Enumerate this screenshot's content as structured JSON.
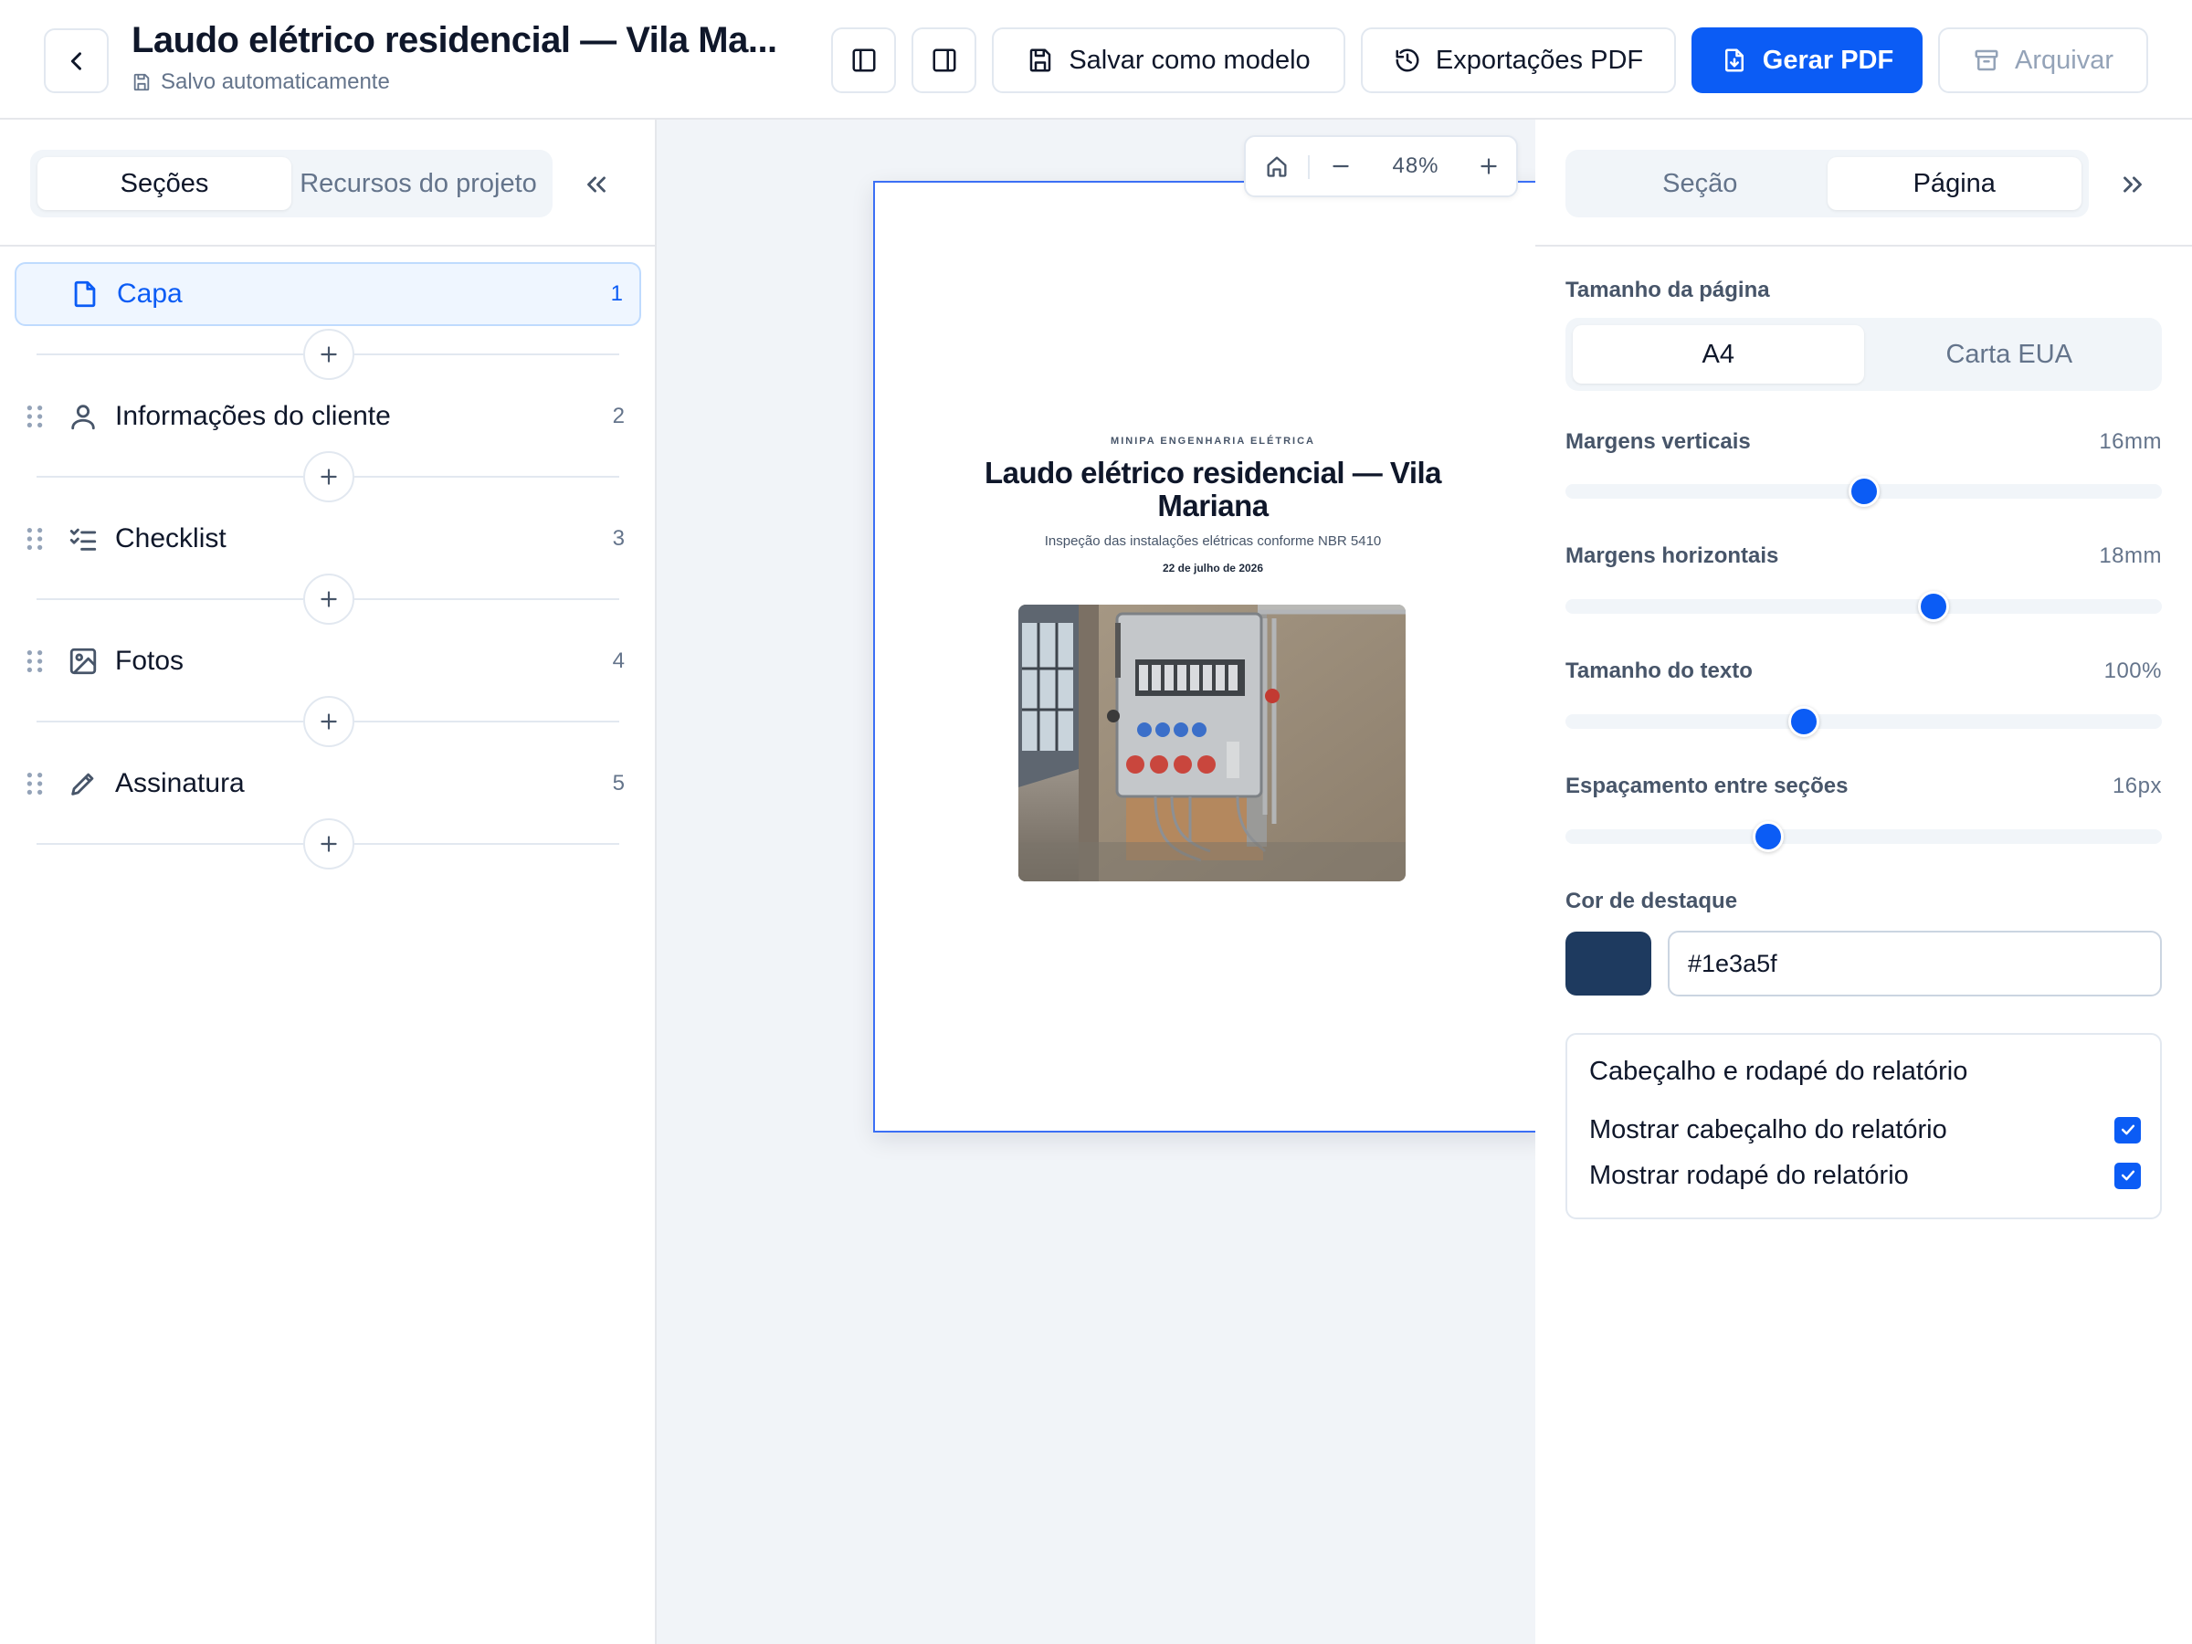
{
  "header": {
    "title": "Laudo elétrico residencial — Vila Ma...",
    "autosave": "Salvo automaticamente",
    "save_template": "Salvar como modelo",
    "exports": "Exportações PDF",
    "generate": "Gerar PDF",
    "archive": "Arquivar"
  },
  "left": {
    "tabs": [
      "Seções",
      "Recursos do projeto"
    ],
    "active_tab": 0,
    "sections": [
      {
        "label": "Capa",
        "num": "1",
        "icon": "file-icon",
        "active": true
      },
      {
        "label": "Informações do cliente",
        "num": "2",
        "icon": "user-icon"
      },
      {
        "label": "Checklist",
        "num": "3",
        "icon": "checklist-icon"
      },
      {
        "label": "Fotos",
        "num": "4",
        "icon": "image-icon"
      },
      {
        "label": "Assinatura",
        "num": "5",
        "icon": "pencil-icon"
      }
    ]
  },
  "canvas": {
    "zoom": "48%",
    "page": {
      "company": "MINIPA ENGENHARIA ELÉTRICA",
      "title": "Laudo elétrico residencial — Vila Mariana",
      "subtitle": "Inspeção das instalações elétricas conforme NBR 5410",
      "date": "22 de julho de 2026"
    }
  },
  "right": {
    "tabs": [
      "Seção",
      "Página"
    ],
    "active_tab": 1,
    "page_size_label": "Tamanho da página",
    "page_sizes": [
      "A4",
      "Carta EUA"
    ],
    "sliders": [
      {
        "label": "Margens verticais",
        "value": "16mm",
        "level": 0.5
      },
      {
        "label": "Margens horizontais",
        "value": "18mm",
        "level": 0.617
      },
      {
        "label": "Tamanho do texto",
        "value": "100%",
        "level": 0.4
      },
      {
        "label": "Espaçamento entre seções",
        "value": "16px",
        "level": 0.34
      }
    ],
    "accent_label": "Cor de destaque",
    "accent_hex": "#1e3a5f",
    "card": {
      "title": "Cabeçalho e rodapé do relatório",
      "show_header": "Mostrar cabeçalho do relatório",
      "show_footer": "Mostrar rodapé do relatório"
    }
  },
  "colors": {
    "primary": "#0b5cf5",
    "accent": "#1e3a5f"
  }
}
